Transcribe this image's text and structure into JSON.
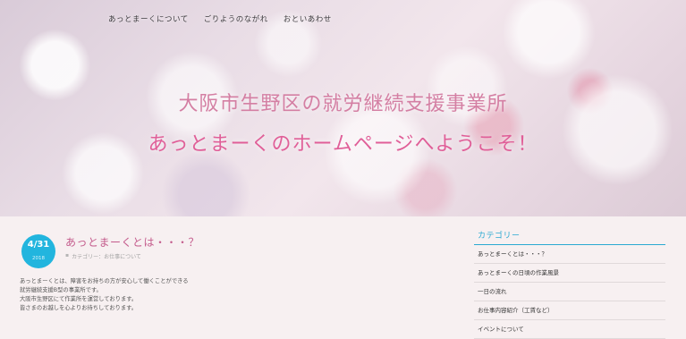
{
  "nav": {
    "items": [
      {
        "label": "あっとまーくについて"
      },
      {
        "label": "ごりようのながれ"
      },
      {
        "label": "おといあわせ"
      }
    ]
  },
  "hero": {
    "title_line1": "大阪市生野区の就労継続支援事業所",
    "title_line2": "あっとまーくのホームページへようこそ！"
  },
  "post": {
    "date_main": "4/31",
    "date_year": "2018",
    "title": "あっとまーくとは・・・？",
    "category": "カテゴリー：お仕事について",
    "body_lines": [
      "あっとまーくとは、障害をお持ちの方が安心して働くことができる",
      "就労継続支援B型の事業所です。",
      "大阪市生野区にて作業所を運営しております。",
      "皆さまのお越しを心よりお待ちしております。"
    ]
  },
  "sidebar": {
    "heading": "カテゴリー",
    "items": [
      {
        "label": "あっとまーくとは・・・？"
      },
      {
        "label": "あっとまーくの日頃の作業風景"
      },
      {
        "label": "一日の流れ"
      },
      {
        "label": "お仕事内容紹介（工賃など）"
      },
      {
        "label": "イベントについて"
      }
    ]
  },
  "colors": {
    "accent": "#22b5de",
    "title_pink": "#e05f98",
    "title_soft_pink": "#d47fa3",
    "post_title": "#c45b8c"
  }
}
